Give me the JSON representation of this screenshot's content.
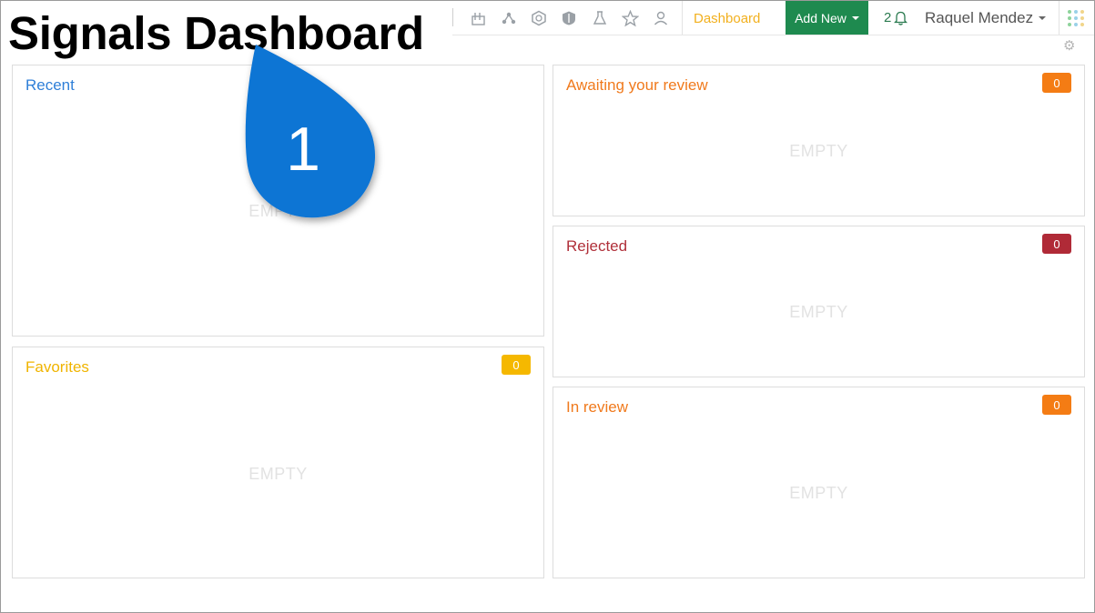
{
  "page_title": "Signals Dashboard",
  "nav": {
    "icons": [
      "flask-rack-icon",
      "molecule-icon",
      "hexagon-icon",
      "shield-icon",
      "beaker-icon",
      "star-icon",
      "user-icon"
    ],
    "dashboard_link": "Dashboard",
    "add_new_label": "Add New",
    "notification_count": "2",
    "user_name": "Raquel Mendez"
  },
  "panels": {
    "recent": {
      "title": "Recent",
      "empty": "EMPTY"
    },
    "favorites": {
      "title": "Favorites",
      "count": "0",
      "empty": "EMPTY"
    },
    "awaiting": {
      "title": "Awaiting your review",
      "count": "0",
      "empty": "EMPTY"
    },
    "rejected": {
      "title": "Rejected",
      "count": "0",
      "empty": "EMPTY"
    },
    "in_review": {
      "title": "In review",
      "count": "0",
      "empty": "EMPTY"
    }
  },
  "callout": {
    "number": "1"
  },
  "colors": {
    "recent": "#2f7fd8",
    "favorites": "#f0b400",
    "awaiting": "#f07a1d",
    "rejected": "#b0303a",
    "add_new_bg": "#1e8a4f",
    "callout": "#0f74d4"
  }
}
